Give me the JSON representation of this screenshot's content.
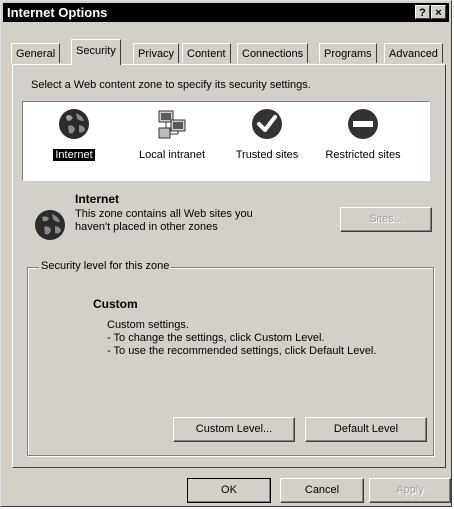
{
  "window": {
    "title": "Internet Options",
    "help_button": "?",
    "close_button": "×"
  },
  "tabs": [
    {
      "label": "General"
    },
    {
      "label": "Security"
    },
    {
      "label": "Privacy"
    },
    {
      "label": "Content"
    },
    {
      "label": "Connections"
    },
    {
      "label": "Programs"
    },
    {
      "label": "Advanced"
    }
  ],
  "security": {
    "instruction": "Select a Web content zone to specify its security settings.",
    "zones": [
      {
        "label": "Internet",
        "icon": "globe-icon"
      },
      {
        "label": "Local intranet",
        "icon": "network-computers-icon"
      },
      {
        "label": "Trusted sites",
        "icon": "checkmark-icon"
      },
      {
        "label": "Restricted sites",
        "icon": "no-entry-icon"
      }
    ],
    "selected_zone": {
      "name": "Internet",
      "description_line1": "This zone contains all Web sites you",
      "description_line2": "haven't placed in other zones",
      "sites_button": "Sites..."
    },
    "level_group": {
      "title": "Security level for this zone",
      "level_name": "Custom",
      "line1": "Custom settings.",
      "line2": "- To change the settings, click Custom Level.",
      "line3": "- To use the recommended settings, click Default Level.",
      "custom_level_button": "Custom Level...",
      "default_level_button": "Default Level"
    }
  },
  "footer": {
    "ok": "OK",
    "cancel": "Cancel",
    "apply": "Apply"
  }
}
